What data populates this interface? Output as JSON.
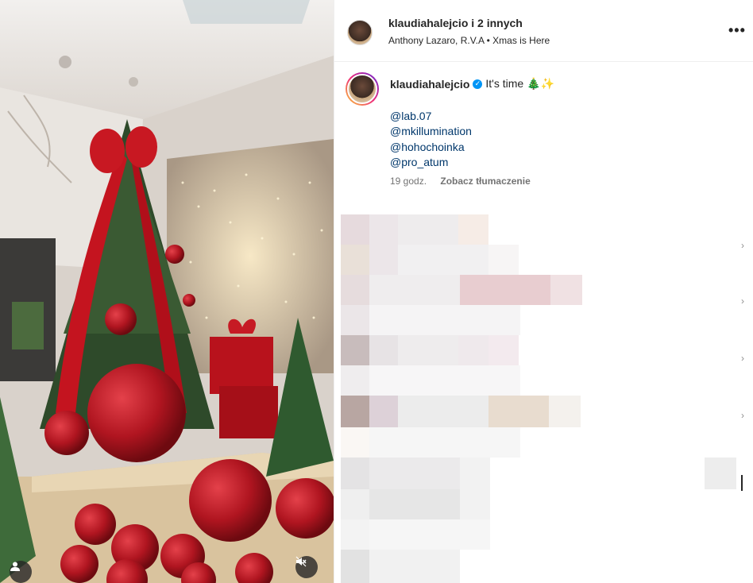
{
  "header": {
    "username": "klaudiahalejcio i 2 innych",
    "subtitle": "Anthony Lazaro, R.V.A • Xmas is Here",
    "more_icon": "more-horizontal-icon"
  },
  "caption": {
    "username": "klaudiahalejcio",
    "verified_icon": "verified-badge-icon",
    "text": "It's time 🎄✨",
    "mentions": [
      "@lab.07",
      "@mkillumination",
      "@hohochoinka",
      "@pro_atum"
    ],
    "time": "19 godz.",
    "translate_label": "Zobacz tłumaczenie"
  },
  "media": {
    "user_tag_icon": "user-icon",
    "mute_icon": "speaker-muted-icon"
  },
  "colors": {
    "link": "#00376b",
    "verified": "#0095f6",
    "text": "#262626",
    "muted": "#737373"
  }
}
